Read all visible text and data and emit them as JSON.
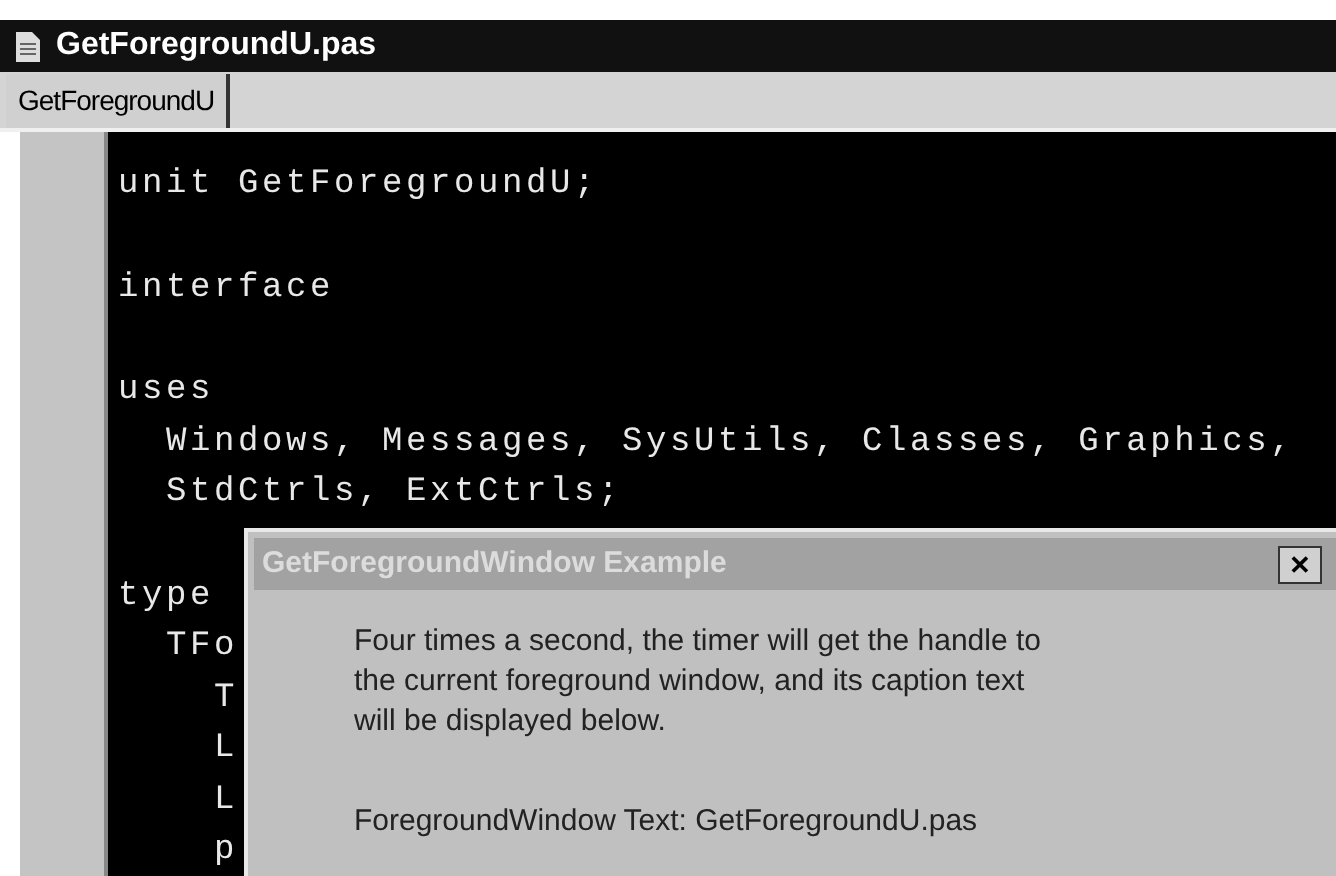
{
  "window": {
    "title": "GetForegroundU.pas"
  },
  "tabs": [
    {
      "label": "GetForegroundU",
      "selected": true
    }
  ],
  "code_lines": [
    {
      "text": "unit GetForegroundU;",
      "blank_before": false
    },
    {
      "text": "interface",
      "blank_before": true
    },
    {
      "text": "uses",
      "blank_before": true
    },
    {
      "text": "  Windows, Messages, SysUtils, Classes, Graphics,",
      "blank_before": false
    },
    {
      "text": "  StdCtrls, ExtCtrls;",
      "blank_before": false
    },
    {
      "text": "type",
      "blank_before": true
    },
    {
      "text": "  TFo",
      "blank_before": false
    },
    {
      "text": "    T",
      "blank_before": false
    },
    {
      "text": "    L",
      "blank_before": false
    },
    {
      "text": "    L",
      "blank_before": false
    },
    {
      "text": "    p",
      "blank_before": false
    }
  ],
  "dialog": {
    "title": "GetForegroundWindow Example",
    "close": "✕",
    "message": "Four times a second, the timer will get the handle to the current foreground window, and its caption text will be displayed below.",
    "result": "ForegroundWindow Text: GetForegroundU.pas"
  }
}
